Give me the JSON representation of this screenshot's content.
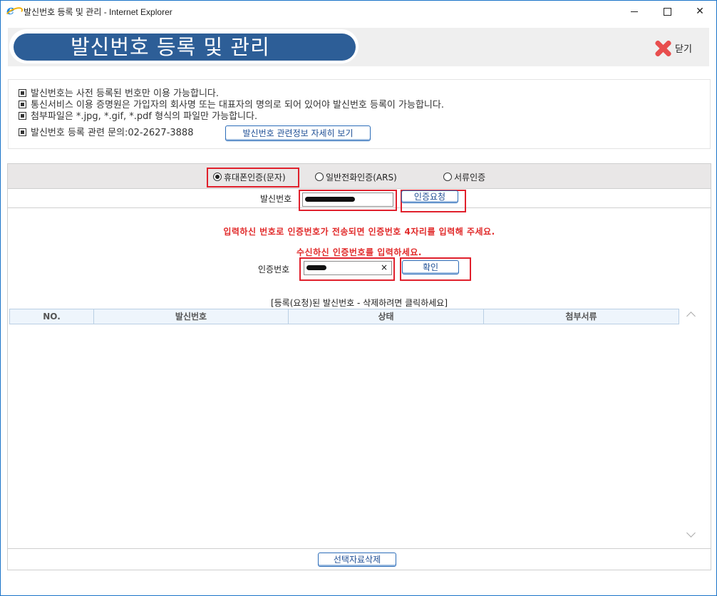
{
  "window": {
    "title": "발신번호 등록 및 관리 - Internet Explorer"
  },
  "header": {
    "title": "발신번호 등록 및 관리",
    "close_label": "닫기"
  },
  "notice": {
    "lines": [
      "발신번호는 사전 등록된 번호만 이용 가능합니다.",
      "통신서비스 이용 증명원은 가입자의 회사명 또는 대표자의 명의로 되어 있어야 발신번호 등록이 가능합니다.",
      "첨부파일은 *.jpg, *.gif, *.pdf 형식의 파일만 가능합니다.",
      "발신번호 등록 관련 문의:02-2627-3888"
    ],
    "detail_button": "발신번호 관련정보 자세히 보기"
  },
  "auth": {
    "options": [
      {
        "label": "휴대폰인증(문자)",
        "selected": true
      },
      {
        "label": "일반전화인증(ARS)",
        "selected": false
      },
      {
        "label": "서류인증",
        "selected": false
      }
    ],
    "sender_label": "발신번호",
    "request_button": "인증요청",
    "message1": "입력하신 번호로 인증번호가 전송되면 인증번호 4자리를 입력해 주세요.",
    "message2": "수신하신 인증번호를 입력하세요.",
    "code_label": "인증번호",
    "clear_glyph": "×",
    "confirm_button": "확인"
  },
  "list": {
    "title": "[등록(요청)된 발신번호 - 삭제하려면 클릭하세요]",
    "columns": [
      "NO.",
      "발신번호",
      "상태",
      "첨부서류"
    ],
    "delete_button": "선택자료삭제"
  },
  "colors": {
    "accent": "#2d5e97",
    "highlight_red": "#e0202c",
    "message_red": "#e12a2a"
  }
}
